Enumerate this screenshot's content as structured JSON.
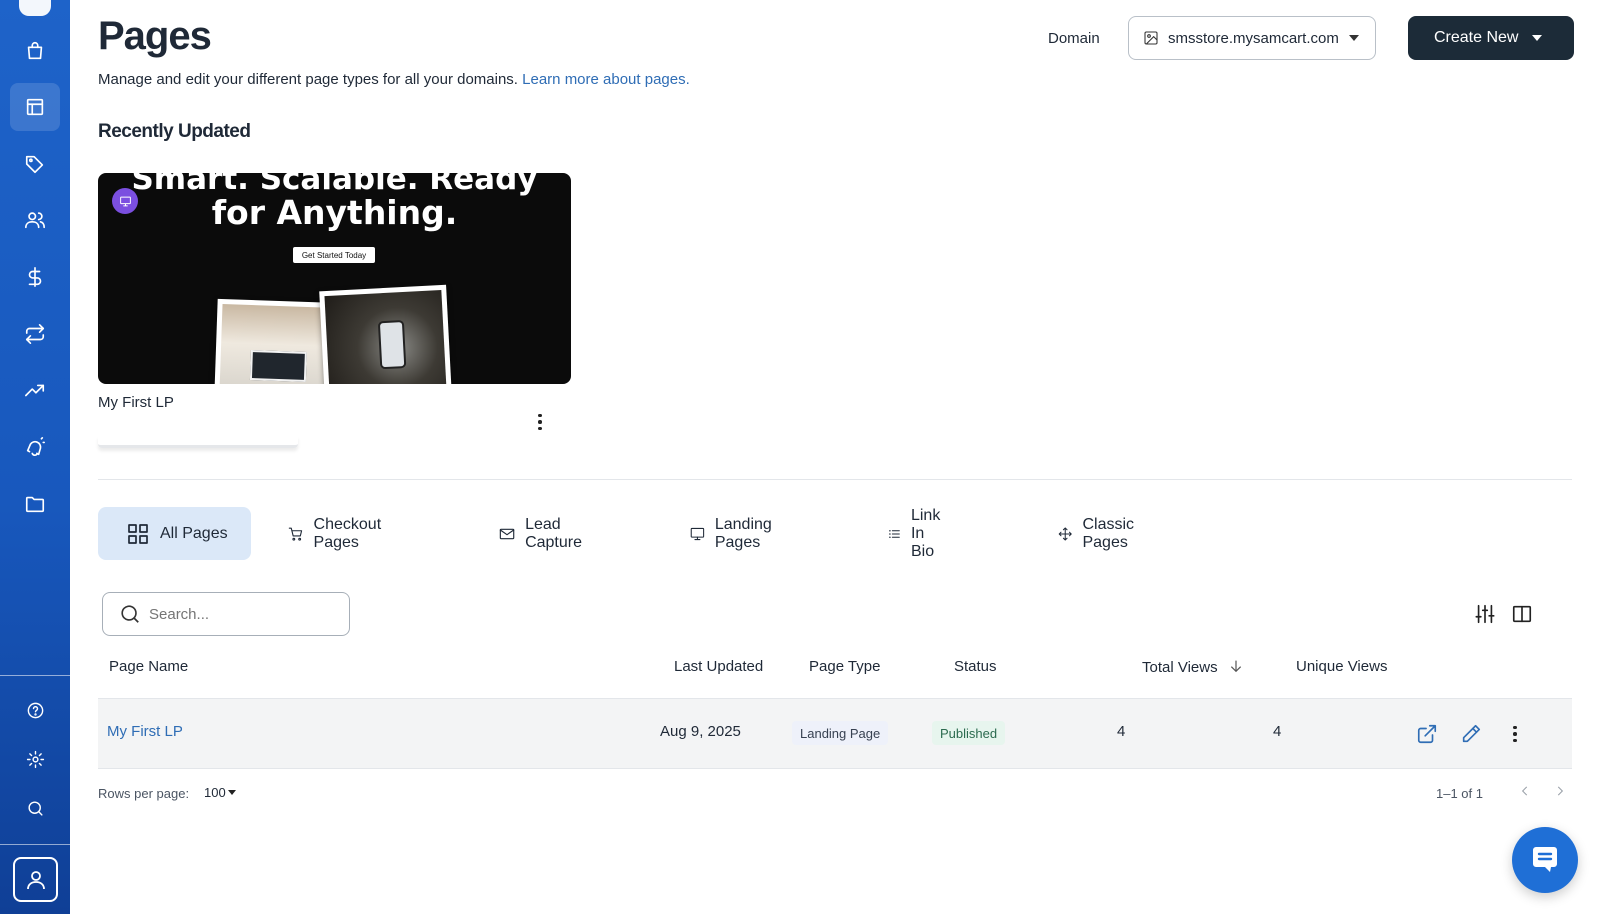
{
  "header": {
    "title": "Pages",
    "subtitle": "Manage and edit your different page types for all your domains.",
    "subtitle_link": "Learn more about pages.",
    "domain_label": "Domain",
    "domain_value": "smsstore.mysamcart.com",
    "create_button": "Create New"
  },
  "recent": {
    "section_title": "Recently Updated",
    "card": {
      "name": "My First LP",
      "thumb_heading_1": "Smart. Scalable. Ready",
      "thumb_heading_2": "for Anything.",
      "thumb_cta": "Get Started Today"
    }
  },
  "tabs": [
    {
      "label": "All Pages",
      "icon": "grid-icon",
      "active": true
    },
    {
      "label": "Checkout Pages",
      "icon": "cart-icon"
    },
    {
      "label": "Lead Capture",
      "icon": "mail-icon"
    },
    {
      "label": "Landing Pages",
      "icon": "monitor-icon"
    },
    {
      "label": "Link In Bio",
      "icon": "list-icon"
    },
    {
      "label": "Classic Pages",
      "icon": "move-icon"
    }
  ],
  "table": {
    "search_placeholder": "Search...",
    "columns": [
      "Page Name",
      "Last Updated",
      "Page Type",
      "Status",
      "Total Views",
      "Unique Views"
    ],
    "sorted_column": "Total Views",
    "rows": [
      {
        "name": "My First LP",
        "last_updated": "Aug 9, 2025",
        "type": "Landing Page",
        "status": "Published",
        "total_views": "4",
        "unique_views": "4"
      }
    ],
    "rows_per_page_label": "Rows per page:",
    "rows_per_page": "100",
    "pagination": "1–1 of 1"
  },
  "sidebar": {
    "items": [
      "store-icon",
      "layout-icon",
      "tag-icon",
      "users-icon",
      "dollar-icon",
      "repeat-icon",
      "trending-icon",
      "bell-icon",
      "folder-icon"
    ],
    "bottom_items": [
      "help-icon",
      "settings-icon",
      "search-icon"
    ]
  },
  "colors": {
    "sidebar": "#1e63c9",
    "primary_button": "#1c2b38",
    "link": "#2f6db5",
    "active_tab": "#dbe8f8",
    "published": "#e7f5ee"
  }
}
